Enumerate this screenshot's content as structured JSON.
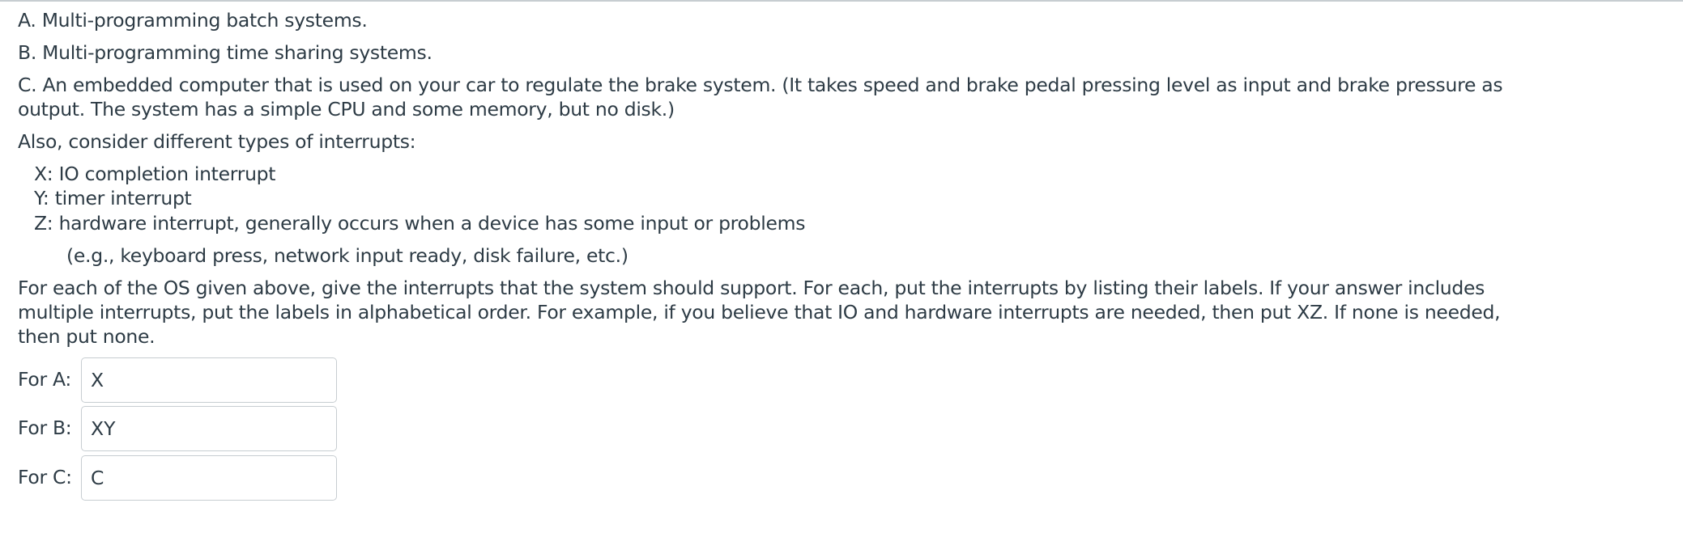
{
  "question": {
    "option_a": "A. Multi-programming batch systems.",
    "option_b": "B. Multi-programming time sharing systems.",
    "option_c_line1": "C. An embedded computer that is used on your car to regulate the brake system. (It takes speed and brake pedal pressing level as input and brake pressure as",
    "option_c_line2": "output. The system has a simple CPU and some memory, but no disk.)",
    "interrupts_intro": "Also, consider different types of interrupts:",
    "interrupt_x": "X: IO completion interrupt",
    "interrupt_y": "Y: timer interrupt",
    "interrupt_z": "Z: hardware interrupt, generally occurs when a device has some input or problems",
    "interrupt_z_examples": "(e.g., keyboard press, network input ready, disk failure, etc.)",
    "instructions_line1": "For each of the OS given above, give the interrupts that the system should support. For each, put the interrupts by listing their labels. If your answer includes",
    "instructions_line2": "multiple interrupts, put the labels in alphabetical order. For example, if you believe that IO and hardware interrupts are needed, then put XZ. If none is needed,",
    "instructions_line3": "then put none."
  },
  "answers": [
    {
      "label": "For A:",
      "value": "X"
    },
    {
      "label": "For B:",
      "value": "XY"
    },
    {
      "label": "For C:",
      "value": "C"
    }
  ]
}
